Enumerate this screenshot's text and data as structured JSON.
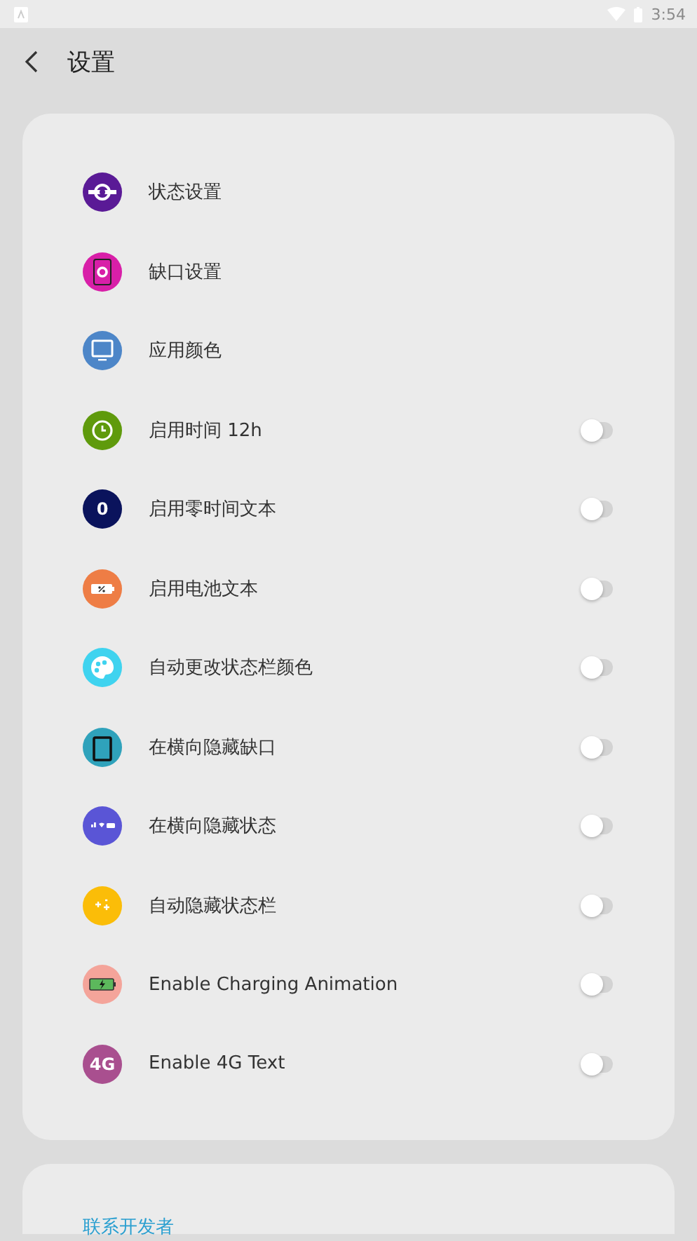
{
  "status_bar": {
    "time": "3:54"
  },
  "app_bar": {
    "title": "设置"
  },
  "settings": [
    {
      "kind": "nav",
      "label": "状态设置",
      "color": "#5a1a96"
    },
    {
      "kind": "nav",
      "label": "缺口设置",
      "color": "#d81fa8"
    },
    {
      "kind": "nav",
      "label": "应用颜色",
      "color": "#4d86c8"
    },
    {
      "kind": "toggle",
      "label": "启用时间 12h",
      "color": "#5f9a0c",
      "on": false
    },
    {
      "kind": "toggle",
      "label": "启用零时间文本",
      "color": "#0a135c",
      "on": false,
      "badge": "0"
    },
    {
      "kind": "toggle",
      "label": "启用电池文本",
      "color": "#ee7d45",
      "on": false
    },
    {
      "kind": "toggle",
      "label": "自动更改状态栏颜色",
      "color": "#3fd3ef",
      "on": false
    },
    {
      "kind": "toggle",
      "label": "在横向隐藏缺口",
      "color": "#2fa2bb",
      "on": false
    },
    {
      "kind": "toggle",
      "label": "在横向隐藏状态",
      "color": "#5a55d6",
      "on": false
    },
    {
      "kind": "toggle",
      "label": "自动隐藏状态栏",
      "color": "#fbbd08",
      "on": false
    },
    {
      "kind": "toggle",
      "label": "Enable Charging Animation",
      "color": "#f4a49a",
      "on": false
    },
    {
      "kind": "toggle",
      "label": "Enable 4G Text",
      "color": "#a94f8f",
      "on": false,
      "badge": "4G"
    }
  ],
  "about": {
    "contact_link": "联系开发者"
  }
}
